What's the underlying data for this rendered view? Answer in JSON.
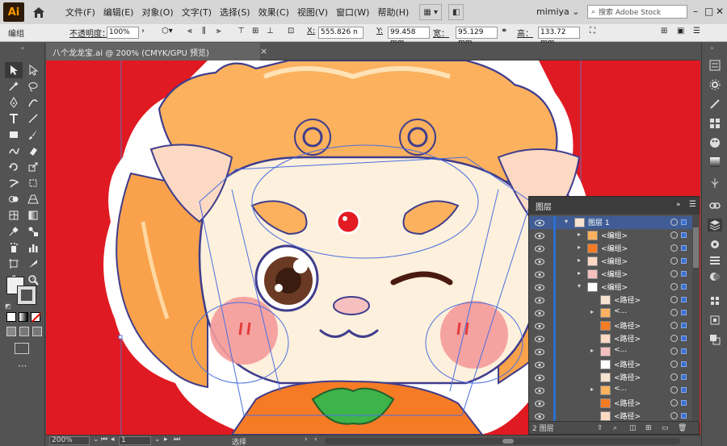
{
  "app": {
    "logo": "Ai",
    "menus": [
      "文件(F)",
      "编辑(E)",
      "对象(O)",
      "文字(T)",
      "选择(S)",
      "效果(C)",
      "视图(V)",
      "窗口(W)",
      "帮助(H)"
    ],
    "user": "mimiya",
    "stock_search_placeholder": "搜索 Adobe Stock"
  },
  "control_bar": {
    "selection_label": "编组",
    "opacity_label": "不透明度：",
    "opacity_value": "100%",
    "x_label": "X:",
    "x_value": "555.826 n",
    "y_label": "Y:",
    "y_value": "99.458 mm",
    "w_label": "宽：",
    "w_value": "95.129 mm",
    "h_label": "高：",
    "h_value": "133.72 mm"
  },
  "document": {
    "tab_title": "八个龙龙宝.ai @ 200% (CMYK/GPU 预览)",
    "close_glyph": "×"
  },
  "layers_panel": {
    "title": "图层",
    "rows": [
      {
        "name": "图层 1",
        "level": 0,
        "arrow": "▾",
        "thumb": "layer"
      },
      {
        "name": "<编组>",
        "level": 1,
        "arrow": "▸"
      },
      {
        "name": "<编组>",
        "level": 1,
        "arrow": "▸"
      },
      {
        "name": "<编组>",
        "level": 1,
        "arrow": "▸"
      },
      {
        "name": "<编组>",
        "level": 1,
        "arrow": "▸"
      },
      {
        "name": "<编组>",
        "level": 1,
        "arrow": "▾"
      },
      {
        "name": "<路径>",
        "level": 2,
        "arrow": ""
      },
      {
        "name": "<...",
        "level": 2,
        "arrow": "▸"
      },
      {
        "name": "<路径>",
        "level": 2,
        "arrow": ""
      },
      {
        "name": "<路径>",
        "level": 2,
        "arrow": ""
      },
      {
        "name": "<...",
        "level": 2,
        "arrow": "▸"
      },
      {
        "name": "<路径>",
        "level": 2,
        "arrow": ""
      },
      {
        "name": "<路径>",
        "level": 2,
        "arrow": ""
      },
      {
        "name": "<...",
        "level": 2,
        "arrow": "▸"
      },
      {
        "name": "<路径>",
        "level": 2,
        "arrow": ""
      },
      {
        "name": "<路径>",
        "level": 2,
        "arrow": ""
      }
    ],
    "footer_count": "2 图层"
  },
  "status_bar": {
    "zoom": "200%",
    "page": "1",
    "tool": "选择"
  },
  "colors": {
    "canvas_red": "#e01a22",
    "ui_dark": "#535353",
    "selection_blue": "#2d6fd0"
  }
}
